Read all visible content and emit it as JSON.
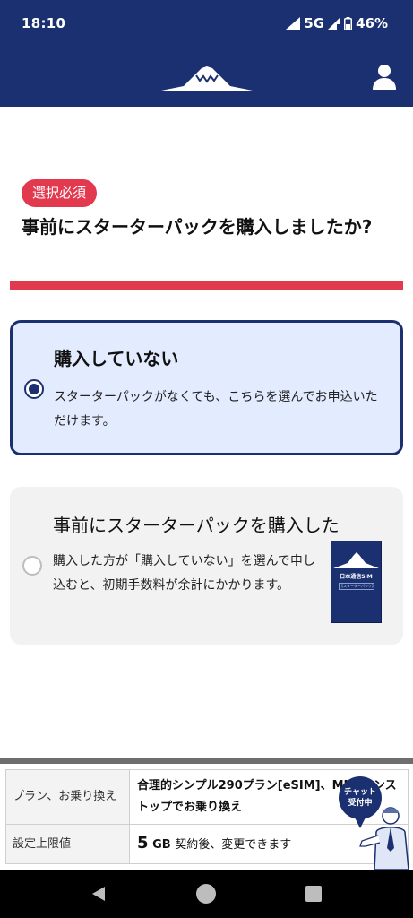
{
  "status_bar": {
    "time": "18:10",
    "network": "5G",
    "battery": "46%"
  },
  "header": {
    "logo_icon": "mount-fuji-logo",
    "account_icon": "user-icon"
  },
  "question": {
    "badge": "選択必須",
    "title": "事前にスターターパックを購入しましたか?"
  },
  "options": [
    {
      "title": "購入していない",
      "description": "スターターパックがなくても、こちらを選んでお申込いただけます。",
      "selected": true
    },
    {
      "title": "事前にスターターパックを購入した",
      "description": "購入した方が「購入していない」を選んで申し込むと、初期手数料が余計にかかります。",
      "selected": false,
      "image_text": "日本通信SIM",
      "image_subtext": "【スターターパック】"
    }
  ],
  "summary": {
    "rows": [
      {
        "label": "プラン、お乗り換え",
        "value": "合理的シンプル290プラン[eSIM]、MNPワンストップでお乗り換え"
      },
      {
        "label": "設定上限値",
        "value_number": "5",
        "value_unit": "GB",
        "value_note": "契約後、変更できます"
      }
    ]
  },
  "chat": {
    "label_line1": "チャット",
    "label_line2": "受付中"
  },
  "colors": {
    "brand_navy": "#1b3070",
    "accent_red": "#e3394f",
    "selected_bg": "#e3ebff"
  }
}
